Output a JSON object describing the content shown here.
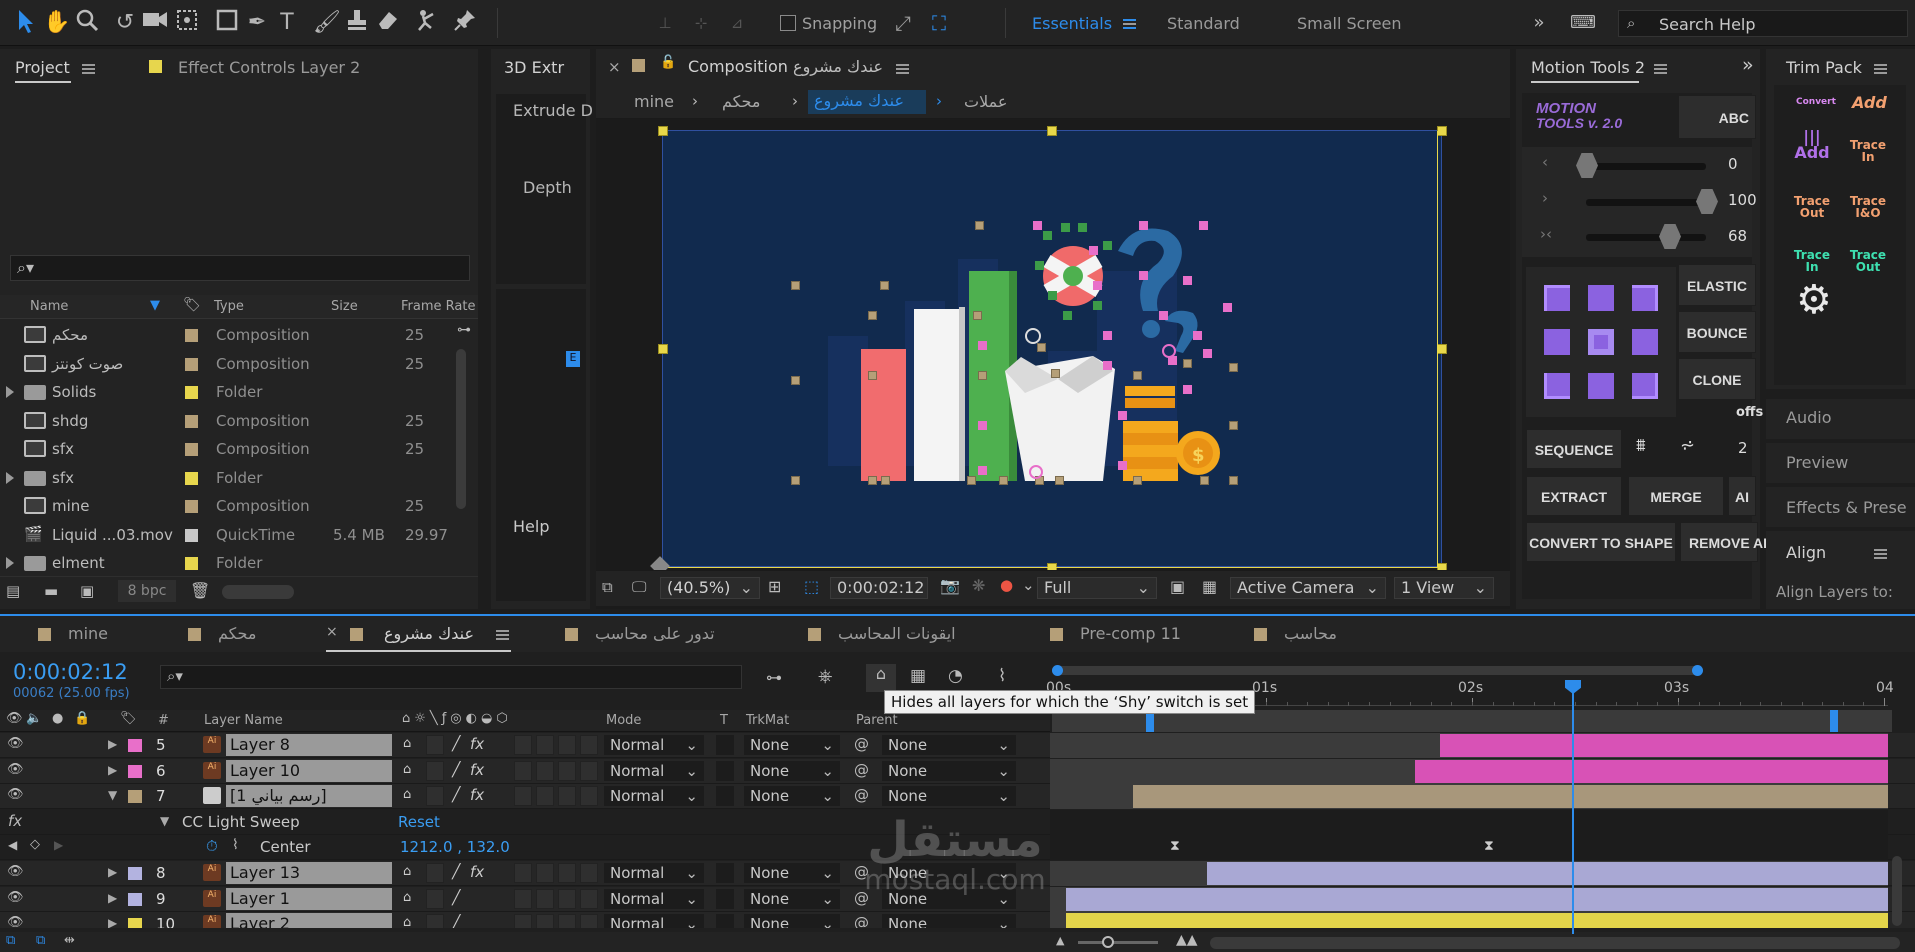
{
  "toolbar": {
    "snapping": "Snapping",
    "workspaces": [
      "Essentials",
      "Standard",
      "Small Screen"
    ],
    "search_placeholder": "Search Help"
  },
  "project_panel": {
    "tab": "Project",
    "effect_controls_tab": "Effect Controls Layer 2",
    "columns": {
      "name": "Name",
      "type": "Type",
      "size": "Size",
      "frame_rate": "Frame Rate"
    },
    "items": [
      {
        "name": "محكم",
        "type": "Composition",
        "size": "",
        "rate": "25",
        "kind": "comp",
        "color": "#b59f78"
      },
      {
        "name": "صوت كونتز",
        "type": "Composition",
        "size": "",
        "rate": "25",
        "kind": "comp",
        "color": "#b59f78"
      },
      {
        "name": "Solids",
        "type": "Folder",
        "size": "",
        "rate": "",
        "kind": "folder",
        "color": "#e7d64d"
      },
      {
        "name": "shdg",
        "type": "Composition",
        "size": "",
        "rate": "25",
        "kind": "comp",
        "color": "#b59f78"
      },
      {
        "name": "sfx",
        "type": "Composition",
        "size": "",
        "rate": "25",
        "kind": "comp",
        "color": "#b59f78"
      },
      {
        "name": "sfx",
        "type": "Folder",
        "size": "",
        "rate": "",
        "kind": "folder",
        "color": "#e7d64d"
      },
      {
        "name": "mine",
        "type": "Composition",
        "size": "",
        "rate": "25",
        "kind": "comp",
        "color": "#b59f78"
      },
      {
        "name": "Liquid ...03.mov",
        "type": "QuickTime",
        "size": "5.4 MB",
        "rate": "29.97",
        "kind": "movie",
        "color": "#c8c8c8"
      },
      {
        "name": "elment",
        "type": "Folder",
        "size": "",
        "rate": "",
        "kind": "folder",
        "color": "#e7d64d"
      }
    ],
    "bpc": "8 bpc"
  },
  "extrude_panel": {
    "tab": "3D Extr",
    "item1": "Extrude D",
    "item2": "Depth",
    "help": "Help"
  },
  "composition_panel": {
    "tab": "Composition",
    "tab_name": "عندك مشروع",
    "breadcrumbs": [
      "mine",
      "محكم",
      "عندك مشروع",
      "عملات"
    ],
    "zoom": "(40.5%)",
    "timecode": "0:00:02:12",
    "resolution": "Full",
    "camera": "Active Camera",
    "view": "1 View"
  },
  "motion_tools": {
    "tab": "Motion Tools 2",
    "logo_line1": "MOTION",
    "logo_line2": "TOOLS v. 2.0",
    "abc_button": "ABC",
    "slider_values": [
      "0",
      "100",
      "68"
    ],
    "buttons": [
      "ELASTIC",
      "BOUNCE",
      "CLONE",
      "SEQUENCE",
      "EXTRACT",
      "MERGE",
      "CONVERT TO SHAPE",
      "REMOVE AI"
    ],
    "offset_label": "offs",
    "sequence_value": "2"
  },
  "trim_pack": {
    "tab": "Trim Pack",
    "buttons": [
      "Convert",
      "Add",
      "Add",
      "Trace In",
      "Trace Out",
      "Trace I&O",
      "Trace In",
      "Trace Out"
    ]
  },
  "side_panels": [
    "Audio",
    "Preview",
    "Effects & Prese",
    "Align"
  ],
  "align_label": "Align Layers to:",
  "timeline": {
    "tabs": [
      "mine",
      "محكم",
      "عندك مشروع",
      "تدور على محاسب",
      "ايقونات المحاسب",
      "Pre-comp 11",
      "محاسب"
    ],
    "active_tab": 2,
    "timecode": "0:00:02:12",
    "fps": "00062 (25.00 fps)",
    "ruler_marks": [
      "00s",
      "01s",
      "02s",
      "03s",
      "04"
    ],
    "tooltip": "Hides all layers for which the ‘Shy’ switch is set",
    "columns": {
      "num": "#",
      "layer_name": "Layer Name",
      "mode": "Mode",
      "t": "T",
      "trkmat": "TrkMat",
      "parent": "Parent"
    },
    "layers": [
      {
        "num": "5",
        "name": "Layer 8",
        "label": "#e86fc9",
        "mode": "Normal",
        "trkmat": "None",
        "parent": "None",
        "bar_start": 0.46,
        "bar_color": "#d852b6",
        "fx": true
      },
      {
        "num": "6",
        "name": "Layer 10",
        "label": "#e86fc9",
        "mode": "Normal",
        "trkmat": "None",
        "parent": "None",
        "bar_start": 0.43,
        "bar_color": "#d852b6",
        "fx": true
      },
      {
        "num": "7",
        "name": "[رسم بياني 1]",
        "label": "#b59f78",
        "mode": "Normal",
        "trkmat": "None",
        "parent": "None",
        "bar_start": 0.09,
        "bar_color": "#a8977b",
        "fx": true,
        "comp": true
      },
      {
        "num": "8",
        "name": "Layer 13",
        "label": "#b3b3e0",
        "mode": "Normal",
        "trkmat": "None",
        "parent": "None",
        "bar_start": 0.18,
        "bar_color": "#a9a8d4",
        "fx": true
      },
      {
        "num": "9",
        "name": "Layer 1",
        "label": "#b3b3e0",
        "mode": "Normal",
        "trkmat": "None",
        "parent": "None",
        "bar_start": 0.01,
        "bar_color": "#a9a8d4",
        "fx": false
      },
      {
        "num": "10",
        "name": "Layer 2",
        "label": "#e7d64d",
        "mode": "Normal",
        "trkmat": "None",
        "parent": "None",
        "bar_start": 0.01,
        "bar_color": "#e3d44a",
        "fx": false
      }
    ],
    "effect": {
      "fx_label": "fx",
      "name": "CC Light Sweep",
      "reset": "Reset",
      "prop": "Center",
      "value": "1212.0 , 132.0"
    }
  },
  "watermark": {
    "arabic": "مستقل",
    "latin": "mostaql.com"
  }
}
